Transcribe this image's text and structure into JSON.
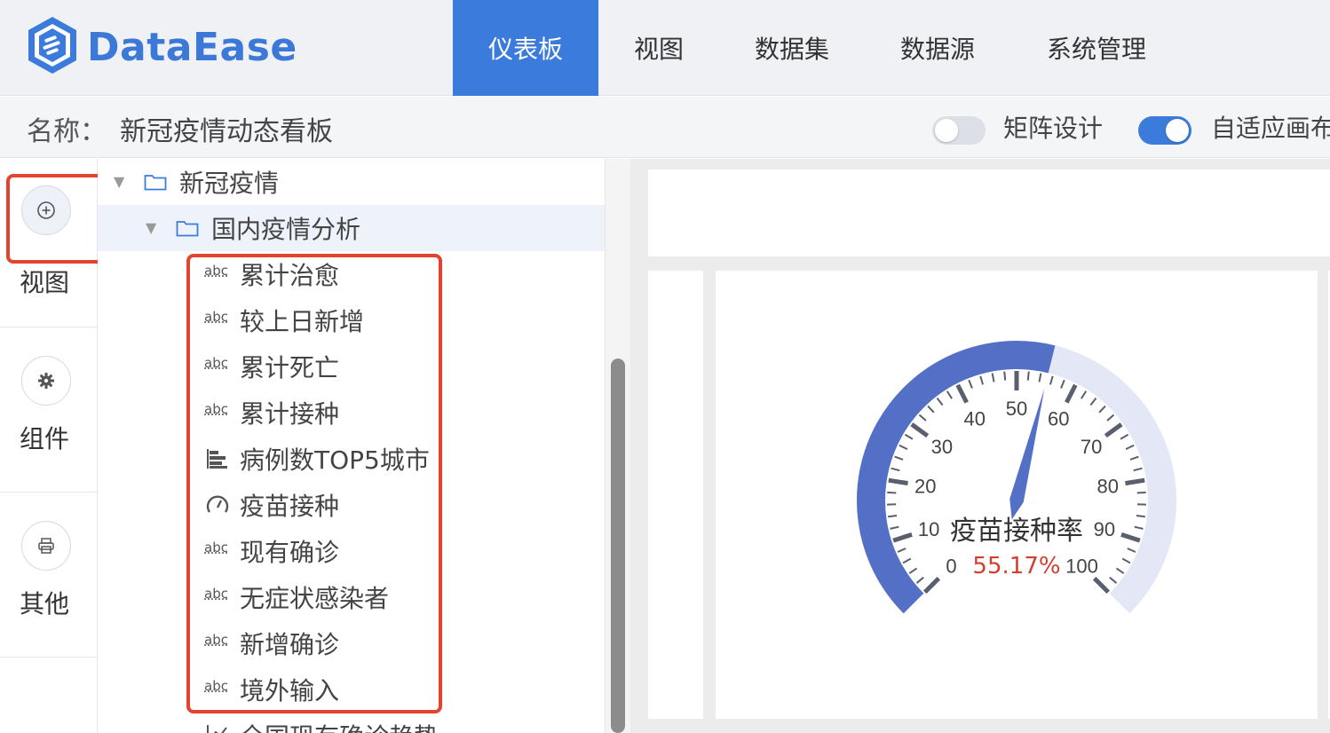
{
  "app": {
    "name": "DataEase",
    "brand_color": "#3a7bdb"
  },
  "nav": {
    "items": [
      {
        "label": "仪表板",
        "active": true
      },
      {
        "label": "视图",
        "active": false
      },
      {
        "label": "数据集",
        "active": false
      },
      {
        "label": "数据源",
        "active": false
      },
      {
        "label": "系统管理",
        "active": false
      }
    ]
  },
  "titlebar": {
    "name_label": "名称：",
    "name_value": "新冠疫情动态看板",
    "matrix_design": {
      "label": "矩阵设计",
      "on": false
    },
    "adaptive_canvas": {
      "label": "自适应画布",
      "on": true
    }
  },
  "rail": {
    "items": [
      {
        "label": "视图",
        "icon": "plus-circle-icon",
        "active": true
      },
      {
        "label": "组件",
        "icon": "gear-icon",
        "active": false
      },
      {
        "label": "其他",
        "icon": "printer-icon",
        "active": false
      }
    ]
  },
  "tree": {
    "root": {
      "label": "新冠疫情",
      "icon": "folder-icon",
      "expanded": true
    },
    "group": {
      "label": "国内疫情分析",
      "icon": "folder-icon",
      "expanded": true
    },
    "items": [
      {
        "label": "累计治愈",
        "icon": "text-abc-icon"
      },
      {
        "label": "较上日新增",
        "icon": "text-abc-icon"
      },
      {
        "label": "累计死亡",
        "icon": "text-abc-icon"
      },
      {
        "label": "累计接种",
        "icon": "text-abc-icon"
      },
      {
        "label": "病例数TOP5城市",
        "icon": "bar-chart-icon"
      },
      {
        "label": "疫苗接种",
        "icon": "gauge-icon"
      },
      {
        "label": "现有确诊",
        "icon": "text-abc-icon"
      },
      {
        "label": "无症状感染者",
        "icon": "text-abc-icon"
      },
      {
        "label": "新增确诊",
        "icon": "text-abc-icon"
      },
      {
        "label": "境外输入",
        "icon": "text-abc-icon"
      },
      {
        "label": "全国现有确诊趋势",
        "icon": "line-chart-icon"
      }
    ]
  },
  "gauge": {
    "title": "疫苗接种率",
    "value": 55.17,
    "value_label": "55.17%",
    "min": 0,
    "max": 100,
    "tick_labels": [
      "0",
      "10",
      "20",
      "30",
      "40",
      "50",
      "60",
      "70",
      "80",
      "90",
      "100"
    ],
    "colors": {
      "progress": "#5470c6",
      "track": "#e4e8f6",
      "pointer": "#5470c6",
      "value": "#d23f31",
      "ticks": "#5a5f6e"
    }
  },
  "colors": {
    "highlight_box": "#e2442f"
  }
}
